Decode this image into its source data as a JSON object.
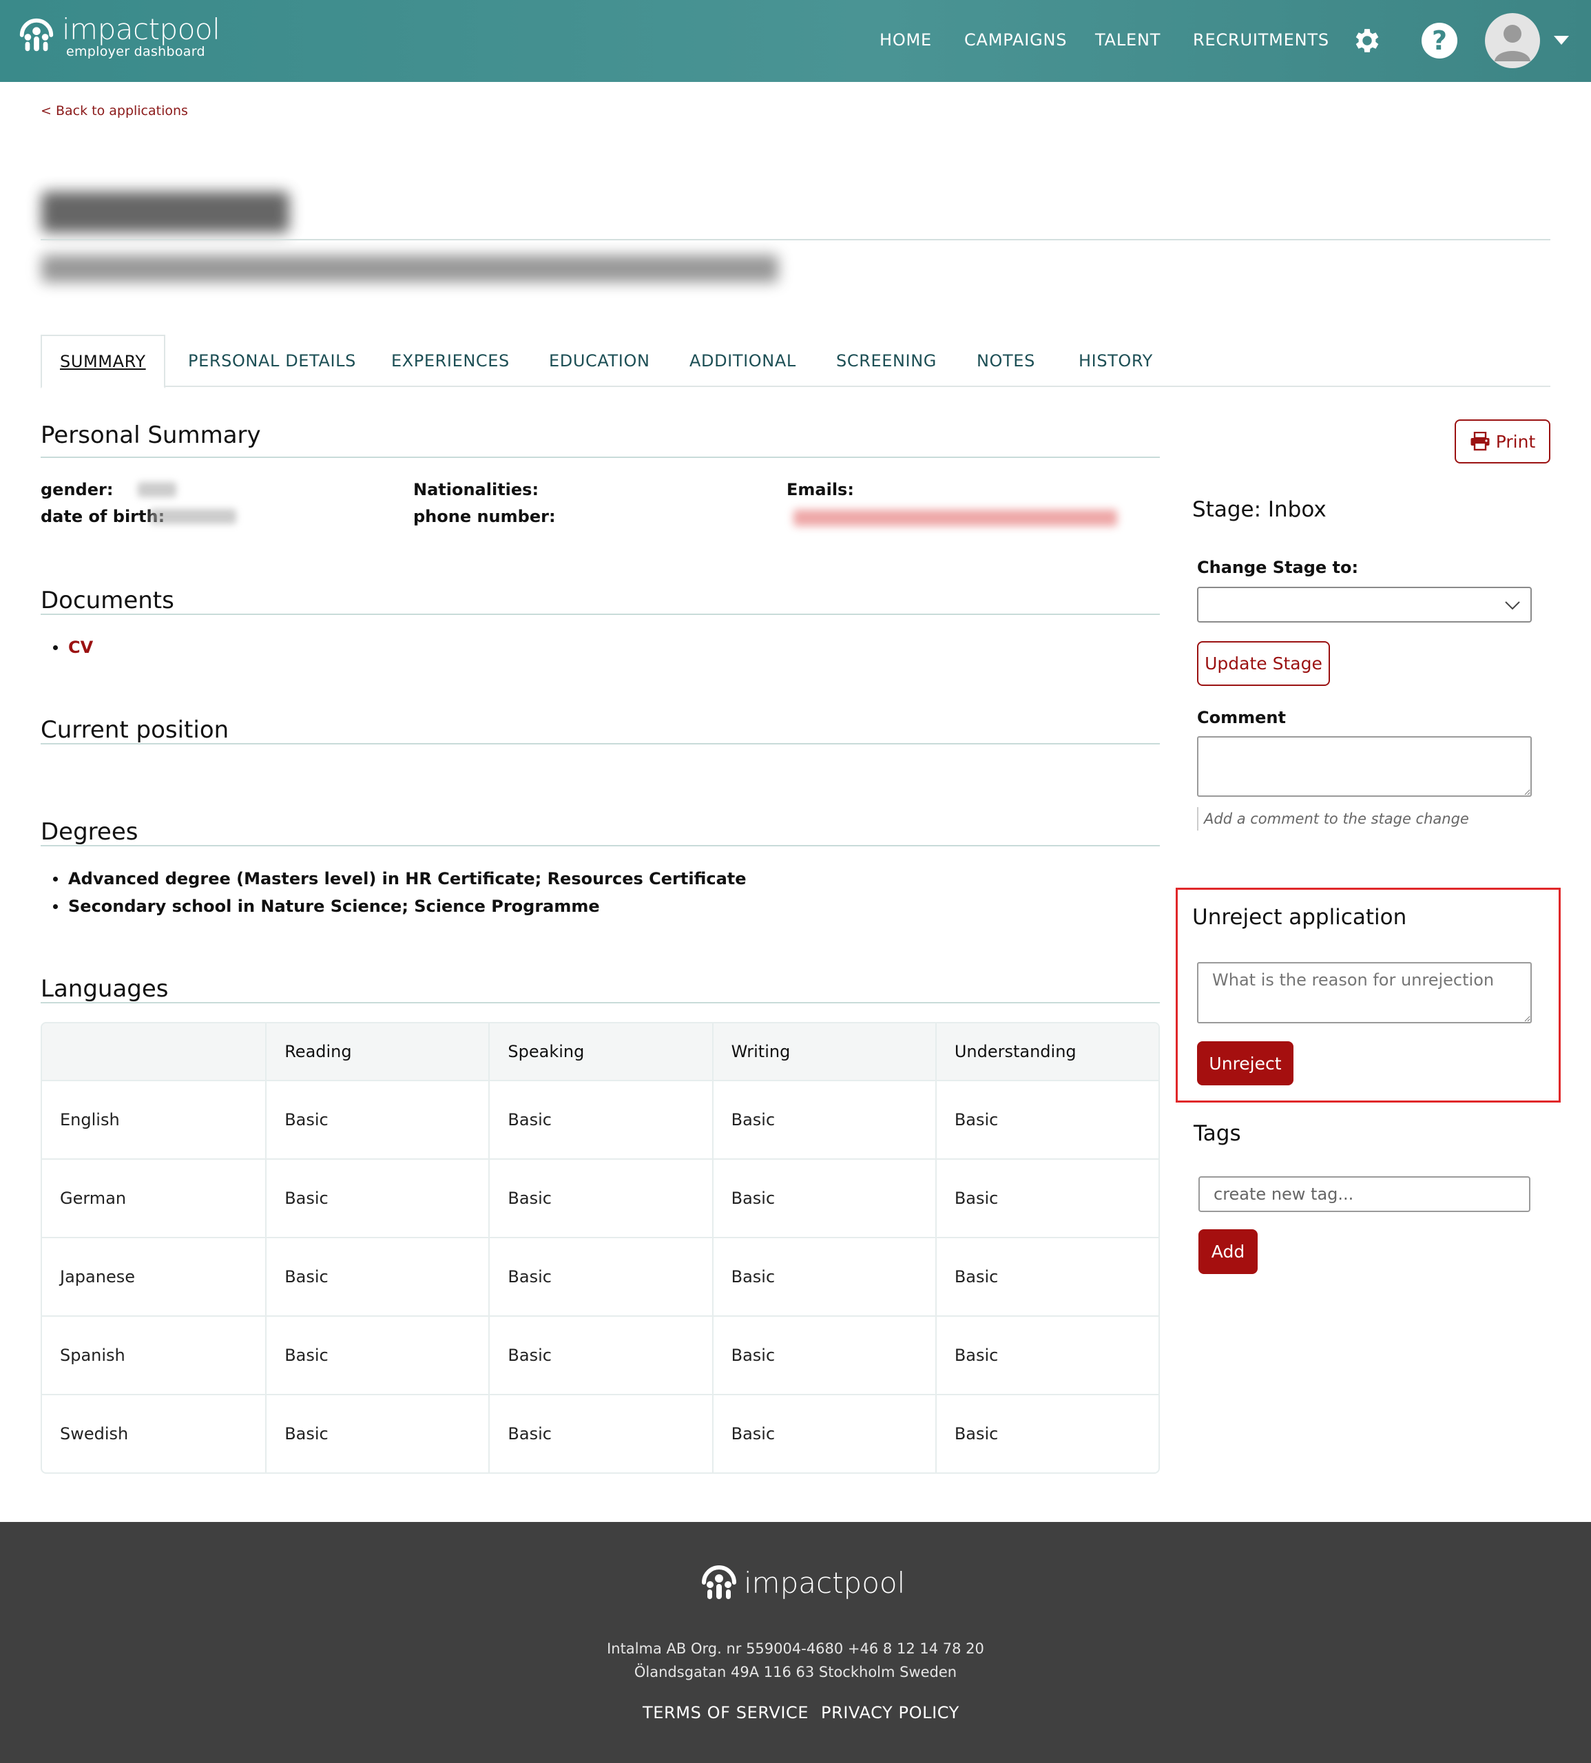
{
  "header": {
    "logo_name": "impactpool",
    "logo_sub": "employer dashboard",
    "nav": [
      "HOME",
      "CAMPAIGNS",
      "TALENT",
      "RECRUITMENTS"
    ],
    "icons": {
      "settings": "gear-icon",
      "help": "help-icon",
      "avatar": "user-avatar",
      "menu": "caret-down-icon"
    },
    "brand_color": "#3d8a8a"
  },
  "back_link": "< Back to applications",
  "tabs": [
    "SUMMARY",
    "PERSONAL DETAILS",
    "EXPERIENCES",
    "EDUCATION",
    "ADDITIONAL",
    "SCREENING",
    "NOTES",
    "HISTORY"
  ],
  "summary": {
    "title": "Personal Summary",
    "labels": {
      "gender": "gender:",
      "dob": "date of birth:",
      "nationalities": "Nationalities:",
      "phone": "phone number:",
      "emails": "Emails:"
    }
  },
  "documents": {
    "title": "Documents",
    "items": [
      "CV"
    ]
  },
  "current_position": {
    "title": "Current position"
  },
  "degrees": {
    "title": "Degrees",
    "items": [
      "Advanced degree (Masters level) in HR Certificate; Resources Certificate",
      "Secondary school in Nature Science; Science Programme"
    ]
  },
  "languages": {
    "title": "Languages",
    "columns": [
      "",
      "Reading",
      "Speaking",
      "Writing",
      "Understanding"
    ],
    "rows": [
      [
        "English",
        "Basic",
        "Basic",
        "Basic",
        "Basic"
      ],
      [
        "German",
        "Basic",
        "Basic",
        "Basic",
        "Basic"
      ],
      [
        "Japanese",
        "Basic",
        "Basic",
        "Basic",
        "Basic"
      ],
      [
        "Spanish",
        "Basic",
        "Basic",
        "Basic",
        "Basic"
      ],
      [
        "Swedish",
        "Basic",
        "Basic",
        "Basic",
        "Basic"
      ]
    ]
  },
  "sidebar": {
    "print_label": "Print",
    "stage_title": "Stage: Inbox",
    "change_stage_label": "Change Stage to:",
    "update_stage_label": "Update Stage",
    "comment_label": "Comment",
    "comment_hint": "Add a comment to the stage change",
    "unreject_title": "Unreject application",
    "unreject_placeholder": "What is the reason for unrejection",
    "unreject_button": "Unreject",
    "tags_title": "Tags",
    "tag_placeholder": "create new tag...",
    "add_button": "Add",
    "accent_color": "#a50f0f",
    "highlight_color": "#e0282a"
  },
  "footer": {
    "logo_name": "impactpool",
    "company_line": "Intalma AB Org. nr 559004-4680 +46 8 12 14 78 20",
    "address_line": "Ölandsgatan 49A 116 63 Stockholm Sweden",
    "links": [
      "TERMS OF SERVICE",
      "PRIVACY POLICY"
    ]
  }
}
